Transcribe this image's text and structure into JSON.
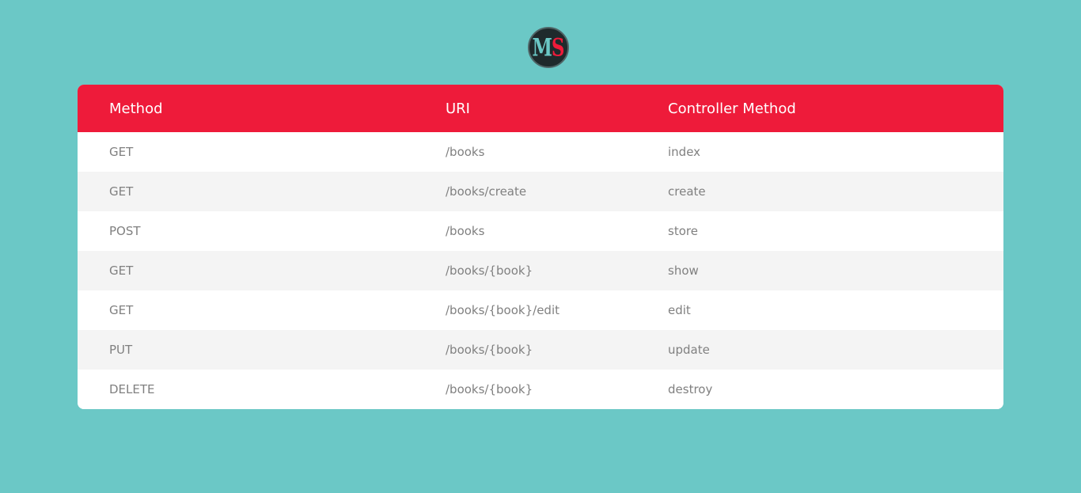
{
  "logo": {
    "left": "M",
    "right": "S"
  },
  "colors": {
    "background": "#6bc8c6",
    "header": "#ee1b3a",
    "row_alt": "#f4f4f4",
    "text": "#808080"
  },
  "table": {
    "headers": {
      "method": "Method",
      "uri": "URI",
      "controller": "Controller Method"
    },
    "rows": [
      {
        "method": "GET",
        "uri": "/books",
        "controller": "index"
      },
      {
        "method": "GET",
        "uri": "/books/create",
        "controller": "create"
      },
      {
        "method": "POST",
        "uri": "/books",
        "controller": "store"
      },
      {
        "method": "GET",
        "uri": "/books/{book}",
        "controller": "show"
      },
      {
        "method": "GET",
        "uri": "/books/{book}/edit",
        "controller": "edit"
      },
      {
        "method": "PUT",
        "uri": "/books/{book}",
        "controller": "update"
      },
      {
        "method": "DELETE",
        "uri": "/books/{book}",
        "controller": "destroy"
      }
    ]
  }
}
